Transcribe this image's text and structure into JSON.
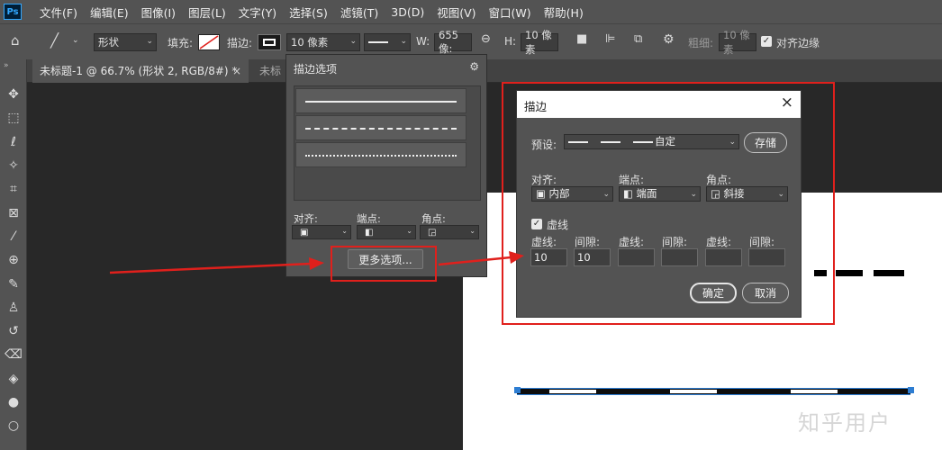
{
  "app": {
    "logo": "Ps"
  },
  "menu": [
    "文件(F)",
    "编辑(E)",
    "图像(I)",
    "图层(L)",
    "文字(Y)",
    "选择(S)",
    "滤镜(T)",
    "3D(D)",
    "视图(V)",
    "窗口(W)",
    "帮助(H)"
  ],
  "options_bar": {
    "shape_mode": "形状",
    "fill_label": "填充:",
    "stroke_label": "描边:",
    "stroke_width": "10 像素",
    "w_label": "W:",
    "w_value": "655 像:",
    "h_label": "H:",
    "h_value": "10 像素",
    "weight_label": "粗细:",
    "weight_value": "10 像素",
    "align_edges": "对齐边缘"
  },
  "tabs": [
    {
      "label": "未标题-1 @ 66.7% (形状 2, RGB/8#) *",
      "close": "×"
    },
    {
      "label": "未标"
    }
  ],
  "stroke_panel": {
    "title": "描边选项",
    "align_label": "对齐:",
    "caps_label": "端点:",
    "corners_label": "角点:",
    "more_options": "更多选项..."
  },
  "dialog": {
    "title": "描边",
    "close": "×",
    "preset_label": "预设:",
    "preset_value": "自定",
    "save": "存储",
    "align_label": "对齐:",
    "align_value": "内部",
    "caps_label": "端点:",
    "caps_value": "端面",
    "corners_label": "角点:",
    "corners_value": "斜接",
    "dashed_label": "虚线",
    "dash_label": "虚线:",
    "gap_label": "间隙:",
    "dash1": "10",
    "gap1": "10",
    "ok": "确定",
    "cancel": "取消"
  },
  "watermark": "知乎用户",
  "colors": {
    "accent_red": "#e0201c",
    "selection_blue": "#2d7dd2"
  }
}
